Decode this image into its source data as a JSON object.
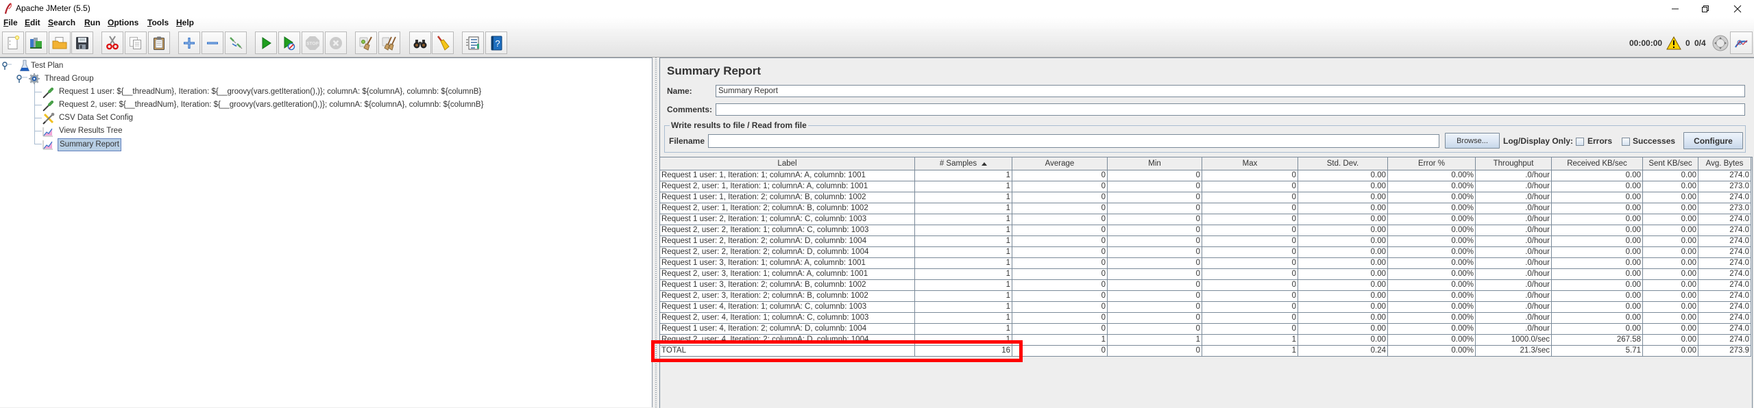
{
  "window": {
    "title": "Apache JMeter (5.5)",
    "app_icon": "jmeter-feather-icon",
    "controls": [
      "minimize-icon",
      "restore-icon",
      "close-icon"
    ]
  },
  "menu": [
    {
      "label": "File"
    },
    {
      "label": "Edit"
    },
    {
      "label": "Search"
    },
    {
      "label": "Run"
    },
    {
      "label": "Options"
    },
    {
      "label": "Tools"
    },
    {
      "label": "Help"
    }
  ],
  "toolbar": {
    "buttons": [
      {
        "icon": "new-document-icon",
        "enabled": true
      },
      {
        "icon": "templates-icon",
        "enabled": true
      },
      {
        "icon": "open-folder-icon",
        "enabled": true
      },
      {
        "icon": "save-icon",
        "enabled": true
      },
      {
        "icon": "cut-icon",
        "enabled": true
      },
      {
        "icon": "copy-icon",
        "enabled": true
      },
      {
        "icon": "paste-icon",
        "enabled": true
      },
      {
        "icon": "expand-icon",
        "enabled": true
      },
      {
        "icon": "collapse-icon",
        "enabled": true
      },
      {
        "icon": "toggle-icon",
        "enabled": true
      },
      {
        "icon": "start-icon",
        "enabled": true
      },
      {
        "icon": "start-no-pauses-icon",
        "enabled": true
      },
      {
        "icon": "stop-icon",
        "enabled": false
      },
      {
        "icon": "shutdown-icon",
        "enabled": false
      },
      {
        "icon": "clear-icon",
        "enabled": true
      },
      {
        "icon": "clear-all-icon",
        "enabled": true
      },
      {
        "icon": "binoculars-icon",
        "enabled": true
      },
      {
        "icon": "reset-search-broom-icon",
        "enabled": true
      },
      {
        "icon": "function-helper-icon",
        "enabled": true
      },
      {
        "icon": "help-icon",
        "enabled": true
      }
    ]
  },
  "status": {
    "elapsed_time": "00:00:00",
    "warning_icon": "warning-icon",
    "error_count": "0",
    "active_threads": "0/4",
    "remote_icon": "globe-icon",
    "log_icon": "log-viewer-icon"
  },
  "tree": {
    "items": [
      {
        "label": "Test Plan",
        "icon": "test-plan-icon",
        "expanded": true
      },
      {
        "label": "Thread Group",
        "icon": "thread-group-icon",
        "expanded": true
      },
      {
        "label": "Request 1 user: ${__threadNum}, Iteration: ${__groovy(vars.getIteration(),)}; columnA: ${columnA}, columnb: ${columnB}",
        "icon": "sampler-icon"
      },
      {
        "label": "Request 2, user: ${__threadNum}, Iteration: ${__groovy(vars.getIteration(),)}; columnA: ${columnA}, columnb: ${columnB}",
        "icon": "sampler-icon"
      },
      {
        "label": "CSV Data Set Config",
        "icon": "config-element-icon"
      },
      {
        "label": "View Results Tree",
        "icon": "listener-icon"
      },
      {
        "label": "Summary Report",
        "icon": "listener-icon",
        "selected": true
      }
    ]
  },
  "summary_report": {
    "title": "Summary Report",
    "name_label": "Name:",
    "name_value": "Summary Report",
    "comments_label": "Comments:",
    "comments_value": "",
    "file_group": {
      "legend": "Write results to file / Read from file",
      "filename_label": "Filename",
      "filename_value": "",
      "browse_label": "Browse...",
      "log_display_label": "Log/Display Only:",
      "errors_label": "Errors",
      "errors_checked": false,
      "successes_label": "Successes",
      "successes_checked": false,
      "configure_label": "Configure"
    }
  },
  "table": {
    "columns": [
      {
        "label": "Label"
      },
      {
        "label": "# Samples",
        "sort": "ascending"
      },
      {
        "label": "Average"
      },
      {
        "label": "Min"
      },
      {
        "label": "Max"
      },
      {
        "label": "Std. Dev."
      },
      {
        "label": "Error %"
      },
      {
        "label": "Throughput"
      },
      {
        "label": "Received KB/sec"
      },
      {
        "label": "Sent KB/sec"
      },
      {
        "label": "Avg. Bytes"
      }
    ],
    "rows": [
      [
        "Request 1 user: 1, Iteration: 1; columnA: A, columnb: 1001",
        "1",
        "0",
        "0",
        "0",
        "0.00",
        "0.00%",
        ".0/hour",
        "0.00",
        "0.00",
        "274.0"
      ],
      [
        "Request 2, user: 1, Iteration: 1; columnA: A, columnb: 1001",
        "1",
        "0",
        "0",
        "0",
        "0.00",
        "0.00%",
        ".0/hour",
        "0.00",
        "0.00",
        "273.0"
      ],
      [
        "Request 1 user: 1, Iteration: 2; columnA: B, columnb: 1002",
        "1",
        "0",
        "0",
        "0",
        "0.00",
        "0.00%",
        ".0/hour",
        "0.00",
        "0.00",
        "274.0"
      ],
      [
        "Request 2, user: 1, Iteration: 2; columnA: B, columnb: 1002",
        "1",
        "0",
        "0",
        "0",
        "0.00",
        "0.00%",
        ".0/hour",
        "0.00",
        "0.00",
        "273.0"
      ],
      [
        "Request 1 user: 2, Iteration: 1; columnA: C, columnb: 1003",
        "1",
        "0",
        "0",
        "0",
        "0.00",
        "0.00%",
        ".0/hour",
        "0.00",
        "0.00",
        "274.0"
      ],
      [
        "Request 2, user: 2, Iteration: 1; columnA: C, columnb: 1003",
        "1",
        "0",
        "0",
        "0",
        "0.00",
        "0.00%",
        ".0/hour",
        "0.00",
        "0.00",
        "274.0"
      ],
      [
        "Request 1 user: 2, Iteration: 2; columnA: D, columnb: 1004",
        "1",
        "0",
        "0",
        "0",
        "0.00",
        "0.00%",
        ".0/hour",
        "0.00",
        "0.00",
        "274.0"
      ],
      [
        "Request 2, user: 2, Iteration: 2; columnA: D, columnb: 1004",
        "1",
        "0",
        "0",
        "0",
        "0.00",
        "0.00%",
        ".0/hour",
        "0.00",
        "0.00",
        "274.0"
      ],
      [
        "Request 1 user: 3, Iteration: 1; columnA: A, columnb: 1001",
        "1",
        "0",
        "0",
        "0",
        "0.00",
        "0.00%",
        ".0/hour",
        "0.00",
        "0.00",
        "274.0"
      ],
      [
        "Request 2, user: 3, Iteration: 1; columnA: A, columnb: 1001",
        "1",
        "0",
        "0",
        "0",
        "0.00",
        "0.00%",
        ".0/hour",
        "0.00",
        "0.00",
        "274.0"
      ],
      [
        "Request 1 user: 3, Iteration: 2; columnA: B, columnb: 1002",
        "1",
        "0",
        "0",
        "0",
        "0.00",
        "0.00%",
        ".0/hour",
        "0.00",
        "0.00",
        "274.0"
      ],
      [
        "Request 2, user: 3, Iteration: 2; columnA: B, columnb: 1002",
        "1",
        "0",
        "0",
        "0",
        "0.00",
        "0.00%",
        ".0/hour",
        "0.00",
        "0.00",
        "274.0"
      ],
      [
        "Request 1 user: 4, Iteration: 1; columnA: C, columnb: 1003",
        "1",
        "0",
        "0",
        "0",
        "0.00",
        "0.00%",
        ".0/hour",
        "0.00",
        "0.00",
        "274.0"
      ],
      [
        "Request 2, user: 4, Iteration: 1; columnA: C, columnb: 1003",
        "1",
        "0",
        "0",
        "0",
        "0.00",
        "0.00%",
        ".0/hour",
        "0.00",
        "0.00",
        "274.0"
      ],
      [
        "Request 1 user: 4, Iteration: 2; columnA: D, columnb: 1004",
        "1",
        "0",
        "0",
        "0",
        "0.00",
        "0.00%",
        ".0/hour",
        "0.00",
        "0.00",
        "274.0"
      ],
      [
        "Request 2, user: 4, Iteration: 2; columnA: D, columnb: 1004",
        "1",
        "1",
        "1",
        "1",
        "0.00",
        "0.00%",
        "1000.0/sec",
        "267.58",
        "0.00",
        "274.0"
      ]
    ],
    "total": [
      "TOTAL",
      "16",
      "0",
      "0",
      "1",
      "0.24",
      "0.00%",
      "21.3/sec",
      "5.71",
      "0.00",
      "273.9"
    ]
  },
  "colors": {
    "background": "#eeeeee",
    "grid": "#7a8a99",
    "selection": "#b8cfe5",
    "selection_border": "#6382bf",
    "annotation": "#ff0000",
    "start_green": "#1f9e1f"
  }
}
